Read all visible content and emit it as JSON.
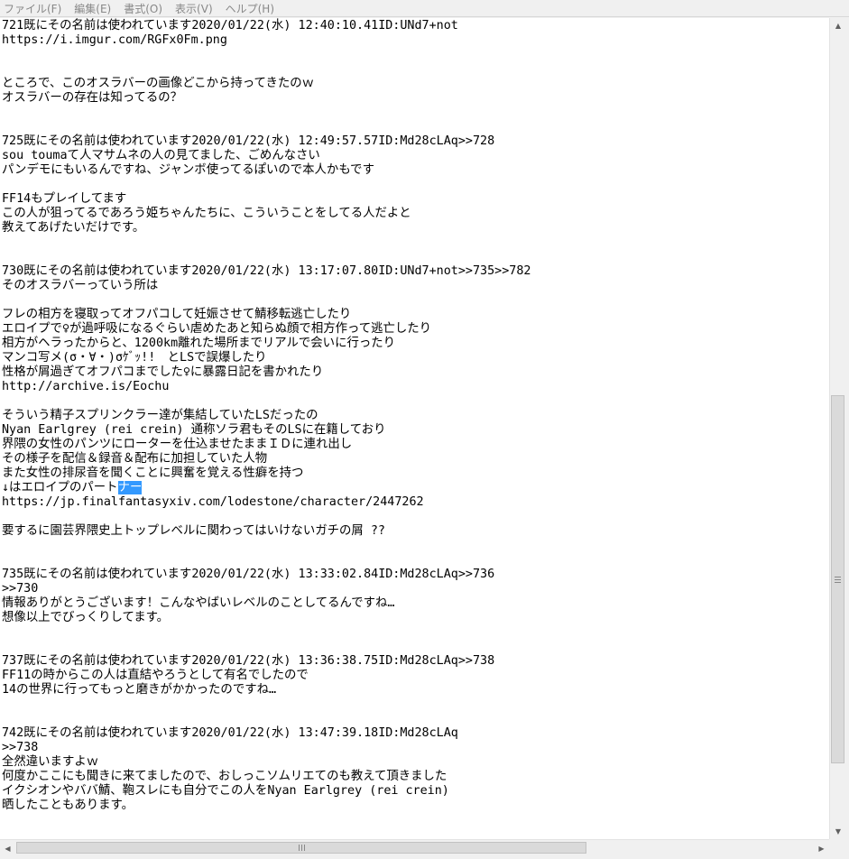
{
  "menu": [
    "ファイル(F)",
    "編集(E)",
    "書式(O)",
    "表示(V)",
    "ヘルプ(H)"
  ],
  "lines": [
    "721既にその名前は使われています2020/01/22(水) 12:40:10.41ID:UNd7+not",
    "https://i.imgur.com/RGFx0Fm.png",
    "",
    "",
    "ところで、このオスラバーの画像どこから持ってきたのｗ",
    "オスラバーの存在は知ってるの？",
    "",
    "",
    "725既にその名前は使われています2020/01/22(水) 12:49:57.57ID:Md28cLAq>>728",
    "sou toumaて人マサムネの人の見てました、ごめんなさい",
    "パンデモにもいるんですね、ジャンボ使ってるぽいので本人かもです",
    "",
    "FF14もプレイしてます",
    "この人が狙ってるであろう姫ちゃんたちに、こういうことをしてる人だよと",
    "教えてあげたいだけです。",
    "",
    "",
    "730既にその名前は使われています2020/01/22(水) 13:17:07.80ID:UNd7+not>>735>>782",
    "そのオスラバーっていう所は",
    "",
    "フレの相方を寝取ってオフパコして妊娠させて鯖移転逃亡したり",
    "エロイプで♀が過呼吸になるぐらい虐めたあと知らぬ顔で相方作って逃亡したり",
    "相方がヘラったからと、1200km離れた場所までリアルで会いに行ったり",
    "マンコ写メ(σ・∀・)σｹﾞｯ!!　とLSで誤爆したり",
    "性格が屑過ぎてオフパコまでした♀に暴露日記を書かれたり",
    "http://archive.is/Eochu",
    "",
    "そういう精子スプリンクラー達が集結していたLSだったの",
    "Nyan Earlgrey (rei crein) 通称ソラ君もそのLSに在籍しており",
    "界隈の女性のパンツにローターを仕込ませたままＩＤに連れ出し",
    "その様子を配信＆録音＆配布に加担していた人物",
    "また女性の排尿音を聞くことに興奮を覚える性癖を持つ",
    "↓はエロイプのパート",
    "https://jp.finalfantasyxiv.com/lodestone/character/2447262",
    "",
    "要するに園芸界隈史上トップレベルに関わってはいけないガチの屑 ??",
    "",
    "",
    "735既にその名前は使われています2020/01/22(水) 13:33:02.84ID:Md28cLAq>>736",
    ">>730",
    "情報ありがとうございます！こんなやばいレベルのことしてるんですね…",
    "想像以上でびっくりしてます。",
    "",
    "",
    "737既にその名前は使われています2020/01/22(水) 13:36:38.75ID:Md28cLAq>>738",
    "FF11の時からこの人は直結やろうとして有名でしたので",
    "14の世界に行ってもっと磨きがかかったのですね…",
    "",
    "",
    "742既にその名前は使われています2020/01/22(水) 13:47:39.18ID:Md28cLAq",
    ">>738",
    "全然違いますよｗ",
    "何度かここにも聞きに来てましたので、おしっこソムリエてのも教えて頂きました",
    "イクシオンやババ鯖、鞄スレにも自分でこの人をNyan Earlgrey (rei crein)",
    "晒したこともあります。"
  ],
  "selection": {
    "line": 32,
    "text": "ナー"
  }
}
